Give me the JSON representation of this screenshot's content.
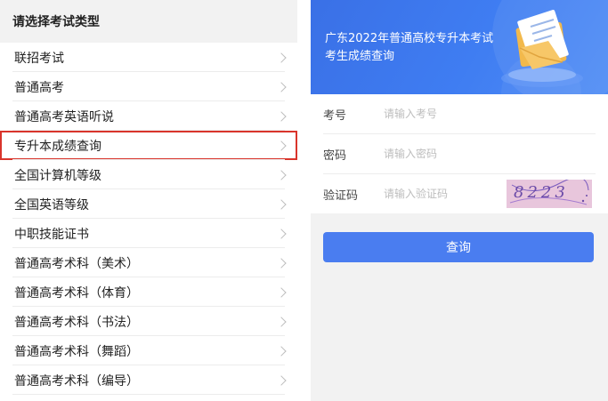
{
  "left_panel": {
    "header": "请选择考试类型",
    "items": [
      {
        "label": "联招考试"
      },
      {
        "label": "普通高考"
      },
      {
        "label": "普通高考英语听说"
      },
      {
        "label": "专升本成绩查询",
        "selected": true
      },
      {
        "label": "全国计算机等级"
      },
      {
        "label": "全国英语等级"
      },
      {
        "label": "中职技能证书"
      },
      {
        "label": "普通高考术科（美术）"
      },
      {
        "label": "普通高考术科（体育）"
      },
      {
        "label": "普通高考术科（书法）"
      },
      {
        "label": "普通高考术科（舞蹈）"
      },
      {
        "label": "普通高考术科（编导）"
      }
    ]
  },
  "right_panel": {
    "banner": {
      "title_line1": "广东2022年普通高校专升本考试",
      "title_line2": "考生成绩查询"
    },
    "form": {
      "exam_no_label": "考号",
      "exam_no_placeholder": "请输入考号",
      "password_label": "密码",
      "password_placeholder": "请输入密码",
      "captcha_label": "验证码",
      "captcha_placeholder": "请输入验证码",
      "captcha_text": "8223"
    },
    "query_button": "查询"
  },
  "colors": {
    "accent": "#4a7df0",
    "selected_outline": "#d9342b",
    "banner_blue": "#3f7df2"
  }
}
